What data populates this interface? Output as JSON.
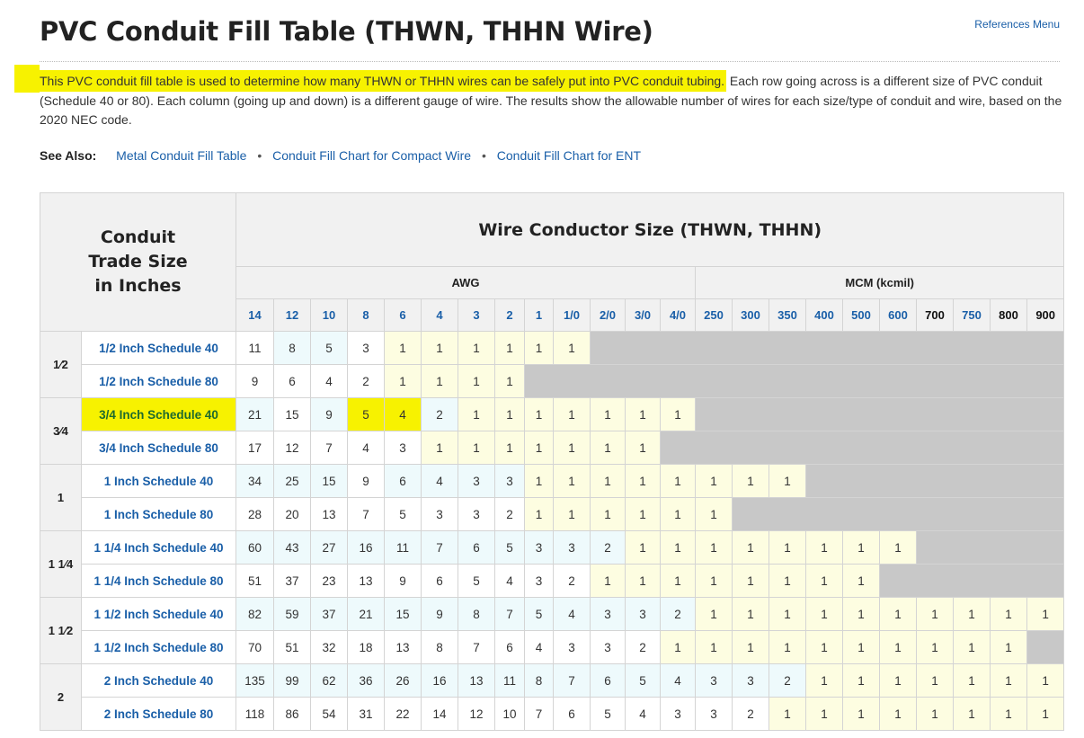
{
  "header": {
    "title": "PVC Conduit Fill Table (THWN, THHN Wire)",
    "references_link": "References Menu"
  },
  "intro": {
    "highlighted": "This PVC conduit fill table is used to determine how many THWN or THHN wires can be safely put into PVC conduit tubing.",
    "rest": " Each row going across is a different size of PVC conduit (Schedule 40 or 80). Each column (going up and down) is a different gauge of wire. The results show the allowable number of wires for each size/type of conduit and wire, based on the 2020 NEC code."
  },
  "see_also": {
    "label": "See Also:",
    "links": [
      "Metal Conduit Fill Table",
      "Conduit Fill Chart for Compact Wire",
      "Conduit Fill Chart for ENT"
    ],
    "separator": "•"
  },
  "table": {
    "corner_header": [
      "Conduit",
      "Trade Size",
      "in Inches"
    ],
    "wire_header": "Wire Conductor Size (THWN, THHN)",
    "groups": [
      {
        "label": "AWG",
        "span": 13
      },
      {
        "label": "MCM (kcmil)",
        "span": 10
      }
    ],
    "gauges": [
      "14",
      "12",
      "10",
      "8",
      "6",
      "4",
      "3",
      "2",
      "1",
      "1/0",
      "2/0",
      "3/0",
      "4/0",
      "250",
      "300",
      "350",
      "400",
      "500",
      "600",
      "700",
      "750",
      "800",
      "900"
    ],
    "gauge_dark": [
      false,
      false,
      false,
      false,
      false,
      false,
      false,
      false,
      false,
      false,
      false,
      false,
      false,
      false,
      false,
      false,
      false,
      false,
      false,
      true,
      false,
      true,
      true
    ],
    "sizes": [
      {
        "size": "1⁄2",
        "rows": [
          {
            "label": "1/2 Inch Schedule 40",
            "values": [
              "11",
              "8",
              "5",
              "3",
              "1",
              "1",
              "1",
              "1",
              "1",
              "1"
            ],
            "styles": "wbbwyyyyyy",
            "highlight_label": false
          },
          {
            "label": "1/2 Inch Schedule 80",
            "values": [
              "9",
              "6",
              "4",
              "2",
              "1",
              "1",
              "1",
              "1"
            ],
            "styles": "wwwwyyyy",
            "highlight_label": false
          }
        ]
      },
      {
        "size": "3⁄4",
        "rows": [
          {
            "label": "3/4 Inch Schedule 40",
            "values": [
              "21",
              "15",
              "9",
              "5",
              "4",
              "2",
              "1",
              "1",
              "1",
              "1",
              "1",
              "1",
              "1"
            ],
            "styles": "bwbhhbyyyyyyy",
            "highlight_label": true
          },
          {
            "label": "3/4 Inch Schedule 80",
            "values": [
              "17",
              "12",
              "7",
              "4",
              "3",
              "1",
              "1",
              "1",
              "1",
              "1",
              "1",
              "1"
            ],
            "styles": "wwwwwyyyyyyy",
            "highlight_label": false
          }
        ]
      },
      {
        "size": "1",
        "rows": [
          {
            "label": "1 Inch Schedule 40",
            "values": [
              "34",
              "25",
              "15",
              "9",
              "6",
              "4",
              "3",
              "3",
              "1",
              "1",
              "1",
              "1",
              "1",
              "1",
              "1",
              "1"
            ],
            "styles": "bbbwbbbbyyyyyyyy",
            "highlight_label": false
          },
          {
            "label": "1 Inch Schedule 80",
            "values": [
              "28",
              "20",
              "13",
              "7",
              "5",
              "3",
              "3",
              "2",
              "1",
              "1",
              "1",
              "1",
              "1",
              "1"
            ],
            "styles": "wwwwwwwwyyyyyy",
            "highlight_label": false
          }
        ]
      },
      {
        "size": "1 1⁄4",
        "rows": [
          {
            "label": "1 1/4 Inch Schedule 40",
            "values": [
              "60",
              "43",
              "27",
              "16",
              "11",
              "7",
              "6",
              "5",
              "3",
              "3",
              "2",
              "1",
              "1",
              "1",
              "1",
              "1",
              "1",
              "1",
              "1"
            ],
            "styles": "bbbbbbbbbbbyyyyyyyy",
            "highlight_label": false
          },
          {
            "label": "1 1/4 Inch Schedule 80",
            "values": [
              "51",
              "37",
              "23",
              "13",
              "9",
              "6",
              "5",
              "4",
              "3",
              "2",
              "1",
              "1",
              "1",
              "1",
              "1",
              "1",
              "1",
              "1"
            ],
            "styles": "wwwwwwwwwwyyyyyyyy",
            "highlight_label": false
          }
        ]
      },
      {
        "size": "1 1⁄2",
        "rows": [
          {
            "label": "1 1/2 Inch Schedule 40",
            "values": [
              "82",
              "59",
              "37",
              "21",
              "15",
              "9",
              "8",
              "7",
              "5",
              "4",
              "3",
              "3",
              "2",
              "1",
              "1",
              "1",
              "1",
              "1",
              "1",
              "1",
              "1",
              "1",
              "1"
            ],
            "styles": "bbbbbbbbbbbbbyyyyyyyyyy",
            "highlight_label": false
          },
          {
            "label": "1 1/2 Inch Schedule 80",
            "values": [
              "70",
              "51",
              "32",
              "18",
              "13",
              "8",
              "7",
              "6",
              "4",
              "3",
              "3",
              "2",
              "1",
              "1",
              "1",
              "1",
              "1",
              "1",
              "1",
              "1",
              "1",
              "1"
            ],
            "styles": "wwwwwwwwwwwwyyyyyyyyyy",
            "highlight_label": false
          }
        ]
      },
      {
        "size": "2",
        "rows": [
          {
            "label": "2 Inch Schedule 40",
            "values": [
              "135",
              "99",
              "62",
              "36",
              "26",
              "16",
              "13",
              "11",
              "8",
              "7",
              "6",
              "5",
              "4",
              "3",
              "3",
              "2",
              "1",
              "1",
              "1",
              "1",
              "1",
              "1",
              "1"
            ],
            "styles": "bbbbbbbbbbbbbbbbyyyyyyy",
            "highlight_label": false
          },
          {
            "label": "2 Inch Schedule 80",
            "values": [
              "118",
              "86",
              "54",
              "31",
              "22",
              "14",
              "12",
              "10",
              "7",
              "6",
              "5",
              "4",
              "3",
              "3",
              "2",
              "1",
              "1",
              "1",
              "1",
              "1",
              "1",
              "1",
              "1"
            ],
            "styles": "wwwwwwwwwwwwwwwyyyyyyyy",
            "highlight_label": false
          }
        ]
      }
    ]
  },
  "colors": {
    "link": "#1a5fa8",
    "highlight": "#f7f200",
    "cell_blue": "#eefafc",
    "cell_yellow": "#fdfde1",
    "cell_gray": "#c8c8c8"
  }
}
